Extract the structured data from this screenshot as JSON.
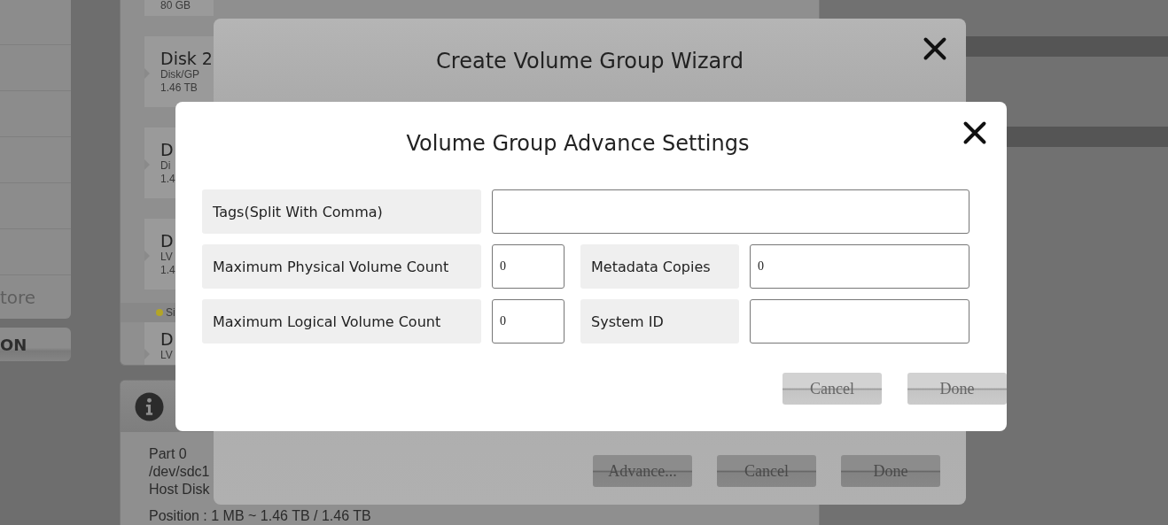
{
  "sidebar": {
    "items": [
      "tore"
    ],
    "button": "ON"
  },
  "disk_list": {
    "items": [
      {
        "lines": [
          "80 GB"
        ]
      },
      {
        "title": "Disk 2",
        "lines": [
          "Disk/GP",
          "1.46 TB"
        ]
      },
      {
        "title": "D",
        "lines": [
          "Di",
          "1.4"
        ]
      },
      {
        "title": "D",
        "lines": [
          "LV",
          "1.4"
        ]
      },
      {
        "title": "D",
        "lines": [
          "LV"
        ],
        "status": {
          "label": "Si",
          "color": "#b3a526"
        }
      }
    ]
  },
  "info_panel": {
    "lines": [
      "Part 0",
      "/dev/sdc1",
      "Host Disk",
      "Position : 1 MB ~ 1.46 TB / 1.46 TB"
    ]
  },
  "wizard": {
    "title": "Create Volume Group Wizard",
    "buttons": [
      "Advance...",
      "Cancel",
      "Done"
    ]
  },
  "advance_dialog": {
    "title": "Volume Group Advance Settings",
    "rows": [
      [
        {
          "label": "Tags(Split With Comma)",
          "kind": "wide"
        }
      ],
      [
        {
          "label": "Maximum Physical Volume Count",
          "value": "0",
          "kind": "short"
        },
        {
          "label": "Metadata Copies",
          "value": "0",
          "kind": "medium"
        }
      ],
      [
        {
          "label": "Maximum Logical Volume Count",
          "value": "0",
          "kind": "short"
        },
        {
          "label": "System ID",
          "kind": "medium"
        }
      ]
    ],
    "buttons": [
      "Cancel",
      "Done"
    ]
  }
}
